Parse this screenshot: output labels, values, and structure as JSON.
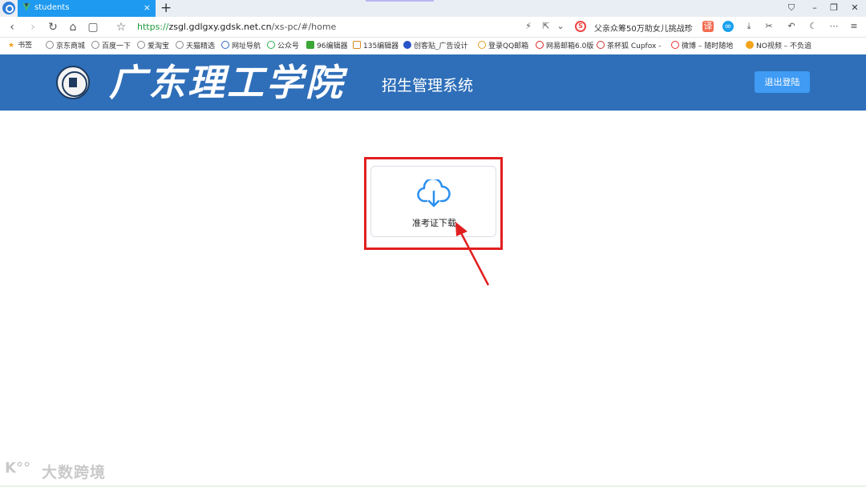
{
  "browser": {
    "tab_title": "students",
    "tab_close": "×",
    "new_tab": "+",
    "url_scheme": "https://",
    "url_domain": "zsgl.gdlgxy.gdsk.net.cn",
    "url_path": "/xs-pc/#/home",
    "search_text": "父亲众筹50万助女儿挑战珍",
    "bookmarks": [
      {
        "label": "书签"
      },
      {
        "label": "京东商城"
      },
      {
        "label": "百度一下"
      },
      {
        "label": "爱淘宝"
      },
      {
        "label": "天猫精选"
      },
      {
        "label": "网址导航"
      },
      {
        "label": "公众号"
      },
      {
        "label": "96编辑器"
      },
      {
        "label": "135编辑器"
      },
      {
        "label": "创客贴_广告设计"
      },
      {
        "label": "登录QQ邮箱"
      },
      {
        "label": "网易邮箱6.0版"
      },
      {
        "label": "茶杯狐 Cupfox -"
      },
      {
        "label": "微博 – 随时随地"
      },
      {
        "label": "NO视频 – 不负追"
      }
    ]
  },
  "header": {
    "college_name": "广东理工学院",
    "system_name": "招生管理系统",
    "logout_label": "退出登陆"
  },
  "main": {
    "card_label": "准考证下载"
  },
  "watermark": {
    "logo": "K°°",
    "text": "大数跨境"
  },
  "colors": {
    "header_bg": "#2f6fb9",
    "tab_active": "#1e9af0",
    "logout_btn": "#3f9bf4",
    "highlight": "#e11f1f",
    "icon_blue": "#2b8ff0"
  }
}
